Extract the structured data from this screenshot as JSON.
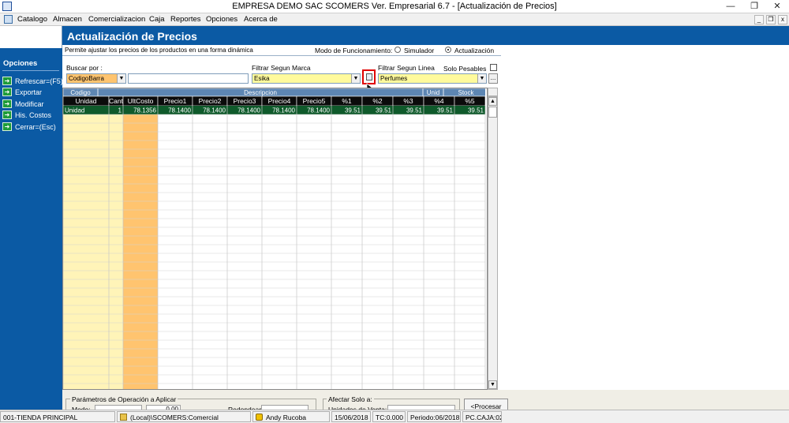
{
  "window": {
    "title": "EMPRESA DEMO SAC        SCOMERS Ver. Empresarial  6.7 - [Actualización de Precios]",
    "minimize": "—",
    "restore": "❐",
    "close": "✕"
  },
  "menu": {
    "items": [
      "Catalogo",
      "Almacen",
      "Comercializacion",
      "Caja",
      "Reportes",
      "Opciones",
      "Acerca de"
    ],
    "mdi_minimize": "_",
    "mdi_restore": "❐",
    "mdi_close": "x"
  },
  "sidebar": {
    "heading": "Opciones",
    "items": [
      {
        "label": "Refrescar=(F5)"
      },
      {
        "label": "Exportar"
      },
      {
        "label": "Modificar"
      },
      {
        "label": "His. Costos"
      },
      {
        "label": "Cerrar=(Esc)"
      }
    ]
  },
  "page": {
    "title": "Actualización de Precios",
    "description": "Permite ajustar los precios de los productos en una forma dinámica",
    "mode_label": "Modo de Funcionamiento:",
    "mode_options": [
      "Simulador",
      "Actualización"
    ],
    "mode_selected": "Actualización"
  },
  "filters": {
    "buscar_label": "Buscar por :",
    "buscar_value": "CodigoBarra",
    "buscar_text": "",
    "marca_label": "Filtrar Segun Marca",
    "marca_value": "Esika",
    "linea_label": "Filtrar Segun Linea",
    "linea_value": "Perfumes",
    "solo_pesables_label": "Solo Pesables",
    "solo_pesables_checked": false,
    "ellipsis": "..."
  },
  "grid": {
    "top_headers": [
      "Codigo",
      "Descripcion",
      "Unid",
      "Stock"
    ],
    "columns": [
      "Unidad",
      "Cant",
      "UltCosto",
      "Precio1",
      "Precio2",
      "Precio3",
      "Precio4",
      "Precio5",
      "%1",
      "%2",
      "%3",
      "%4",
      "%5"
    ],
    "rows": [
      [
        "Unidad",
        "1",
        "78.1356",
        "78.1400",
        "78.1400",
        "78.1400",
        "78.1400",
        "78.1400",
        "39.51",
        "39.51",
        "39.51",
        "39.51",
        "39.51"
      ]
    ]
  },
  "bottom": {
    "params_title": "Parámetros de Operación a Aplicar",
    "modo_label": "Modo:",
    "value": "0.00",
    "redondear_label": "Redondear a:",
    "afectar_title": "Afectar Solo a:",
    "unidades_label": "Unidades de Venta:",
    "procesar_label": "<Procesar"
  },
  "status": {
    "cells": [
      "001-TIENDA PRINCIPAL",
      "(Local)\\SCOMERS:Comercial",
      "Andy Rucoba",
      "15/06/2018",
      "TC:0.000",
      "Periodo:06/2018",
      "PC.CAJA:02"
    ]
  },
  "colors": {
    "sidebar_blue": "#0b5aa4",
    "header_black": "#0b0b0b",
    "selected_row": "#0f5a2b",
    "yellow_col": "#fff4b8",
    "orange_col": "#ffc46f",
    "highlight_red": "#e00000"
  }
}
